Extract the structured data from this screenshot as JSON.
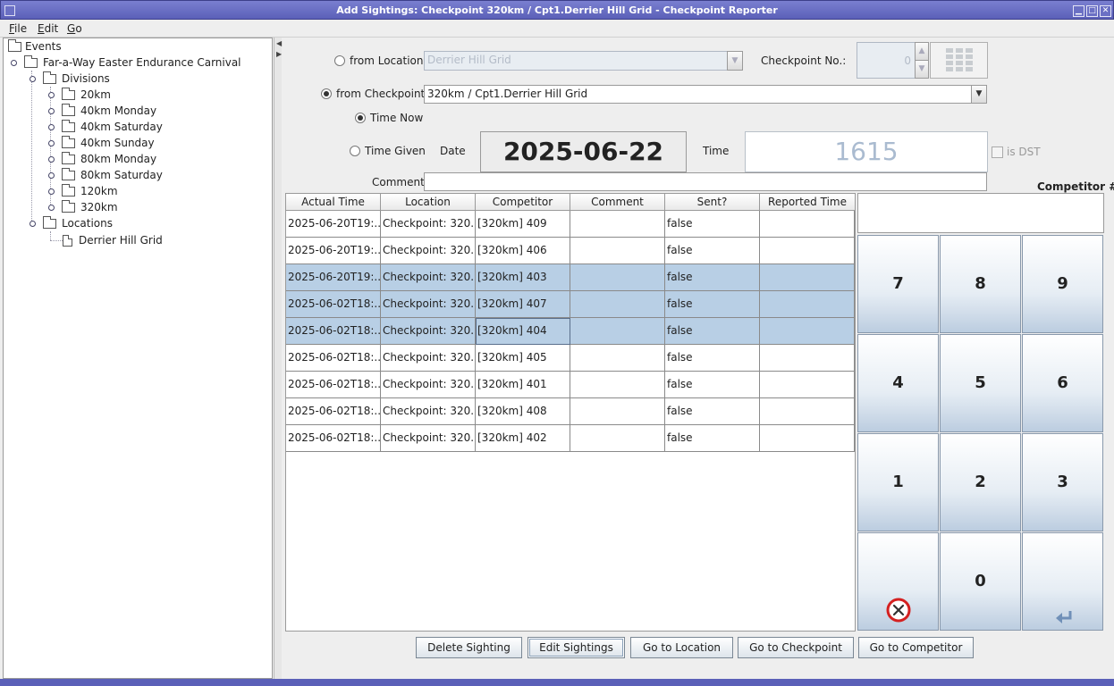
{
  "window": {
    "title": "Add Sightings: Checkpoint 320km / Cpt1.Derrier Hill Grid - Checkpoint Reporter"
  },
  "menu": {
    "items": [
      {
        "label": "File",
        "mnemonic": "F",
        "rest": "ile"
      },
      {
        "label": "Edit",
        "mnemonic": "E",
        "rest": "dit"
      },
      {
        "label": "Go",
        "mnemonic": "G",
        "rest": "o"
      }
    ]
  },
  "tree": {
    "root": "Events",
    "event": "Far-a-Way Easter Endurance Carnival",
    "divisions_label": "Divisions",
    "divisions": [
      "20km",
      "40km Monday",
      "40km Saturday",
      "40km Sunday",
      "80km Monday",
      "80km Saturday",
      "120km",
      "320km"
    ],
    "locations_label": "Locations",
    "locations": [
      "Derrier Hill Grid"
    ]
  },
  "form": {
    "from_location_label": "from Location",
    "from_location_value": "Derrier Hill Grid",
    "checkpoint_no_label": "Checkpoint No.:",
    "checkpoint_no_value": "0",
    "from_checkpoint_label": "from Checkpoint",
    "from_checkpoint_value": "320km / Cpt1.Derrier Hill Grid",
    "time_now_label": "Time Now",
    "time_given_label": "Time Given",
    "date_label": "Date",
    "date_value": "2025-06-22",
    "time_label": "Time",
    "time_value": "1615",
    "is_dst_label": "is DST",
    "comment_label": "Comment:",
    "comment_value": "",
    "competitor_label": "Competitor #:",
    "selected_mode": "from_checkpoint",
    "time_mode": "time_now"
  },
  "table": {
    "columns": [
      "Actual Time",
      "Location",
      "Competitor",
      "Comment",
      "Sent?",
      "Reported Time"
    ],
    "rows": [
      {
        "actual_time": "2025-06-20T19:...",
        "location": "Checkpoint: 320...",
        "competitor": "[320km] 409",
        "comment": "",
        "sent": "false",
        "reported_time": "",
        "selected": false
      },
      {
        "actual_time": "2025-06-20T19:...",
        "location": "Checkpoint: 320...",
        "competitor": "[320km] 406",
        "comment": "",
        "sent": "false",
        "reported_time": "",
        "selected": false
      },
      {
        "actual_time": "2025-06-20T19:...",
        "location": "Checkpoint: 320...",
        "competitor": "[320km] 403",
        "comment": "",
        "sent": "false",
        "reported_time": "",
        "selected": true
      },
      {
        "actual_time": "2025-06-02T18:...",
        "location": "Checkpoint: 320...",
        "competitor": "[320km] 407",
        "comment": "",
        "sent": "false",
        "reported_time": "",
        "selected": true
      },
      {
        "actual_time": "2025-06-02T18:...",
        "location": "Checkpoint: 320...",
        "competitor": "[320km] 404",
        "comment": "",
        "sent": "false",
        "reported_time": "",
        "selected": true
      },
      {
        "actual_time": "2025-06-02T18:...",
        "location": "Checkpoint: 320...",
        "competitor": "[320km] 405",
        "comment": "",
        "sent": "false",
        "reported_time": "",
        "selected": false
      },
      {
        "actual_time": "2025-06-02T18:...",
        "location": "Checkpoint: 320...",
        "competitor": "[320km] 401",
        "comment": "",
        "sent": "false",
        "reported_time": "",
        "selected": false
      },
      {
        "actual_time": "2025-06-02T18:...",
        "location": "Checkpoint: 320...",
        "competitor": "[320km] 408",
        "comment": "",
        "sent": "false",
        "reported_time": "",
        "selected": false
      },
      {
        "actual_time": "2025-06-02T18:...",
        "location": "Checkpoint: 320...",
        "competitor": "[320km] 402",
        "comment": "",
        "sent": "false",
        "reported_time": "",
        "selected": false
      }
    ]
  },
  "keypad": {
    "keys": [
      "7",
      "8",
      "9",
      "4",
      "5",
      "6",
      "1",
      "2",
      "3",
      "clear",
      "0",
      "enter"
    ],
    "competitor_value": ""
  },
  "buttons": {
    "delete_sighting": "Delete Sighting",
    "edit_sightings": "Edit Sightings",
    "go_to_location": "Go to Location",
    "go_to_checkpoint": "Go to Checkpoint",
    "go_to_competitor": "Go to Competitor"
  }
}
